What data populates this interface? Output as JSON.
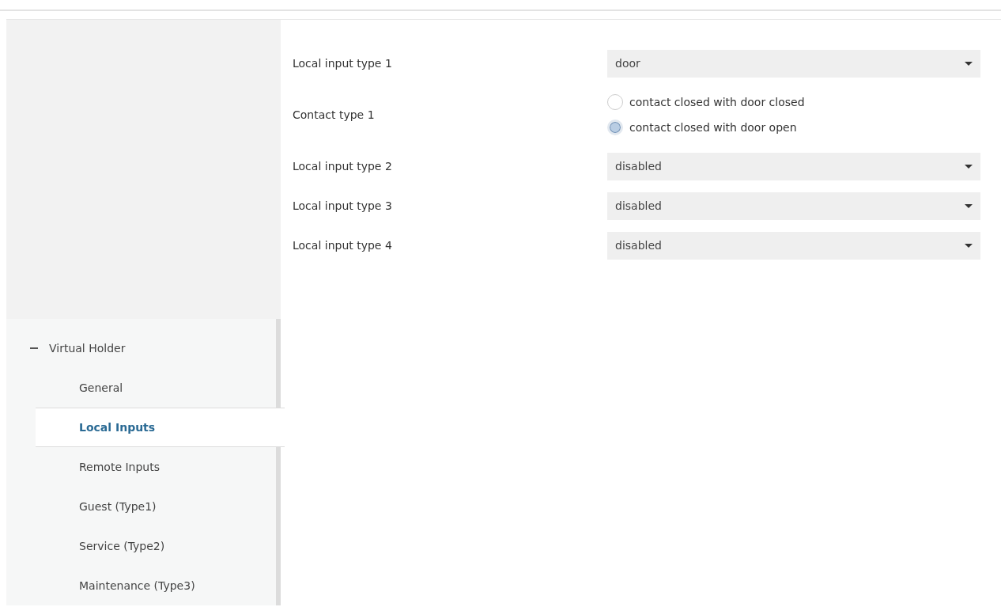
{
  "tree": [
    {
      "label": "Virtual Holder",
      "expanded": true,
      "children": [
        {
          "label": "General",
          "selected": false
        },
        {
          "label": "Local Inputs",
          "selected": true
        },
        {
          "label": "Remote Inputs",
          "selected": false
        },
        {
          "label": "Guest (Type1)",
          "selected": false
        },
        {
          "label": "Service (Type2)",
          "selected": false
        },
        {
          "label": "Maintenance (Type3)",
          "selected": false
        }
      ]
    }
  ],
  "parameters": [
    {
      "kind": "dropdown",
      "label": "Local input type 1",
      "value": "door"
    },
    {
      "kind": "radio",
      "label": "Contact type 1",
      "options": [
        {
          "label": "contact closed with door closed",
          "selected": false
        },
        {
          "label": "contact closed with door open",
          "selected": true
        }
      ]
    },
    {
      "kind": "dropdown",
      "label": "Local input type 2",
      "value": "disabled"
    },
    {
      "kind": "dropdown",
      "label": "Local input type 3",
      "value": "disabled"
    },
    {
      "kind": "dropdown",
      "label": "Local input type 4",
      "value": "disabled"
    }
  ]
}
